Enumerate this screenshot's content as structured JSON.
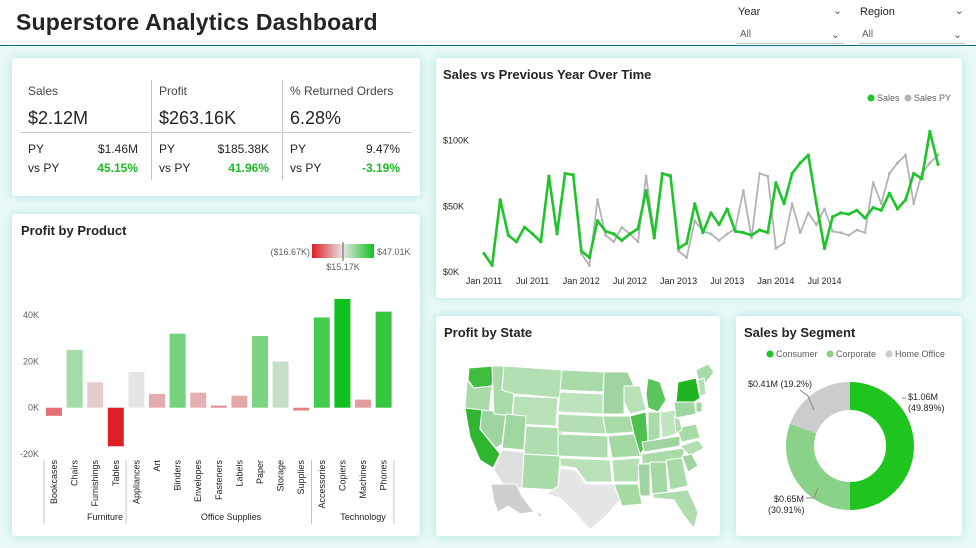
{
  "header": {
    "title": "Superstore Analytics Dashboard",
    "slicers": [
      {
        "label": "Year",
        "value": "All"
      },
      {
        "label": "Region",
        "value": "All"
      }
    ]
  },
  "kpis": [
    {
      "label": "Sales",
      "value": "$2.12M",
      "py_label": "PY",
      "py_value": "$1.46M",
      "vs_label": "vs PY",
      "vs_value": "45.15%"
    },
    {
      "label": "Profit",
      "value": "$263.16K",
      "py_label": "PY",
      "py_value": "$185.38K",
      "vs_label": "vs PY",
      "vs_value": "41.96%"
    },
    {
      "label": "% Returned Orders",
      "value": "6.28%",
      "py_label": "PY",
      "py_value": "9.47%",
      "vs_label": "vs PY",
      "vs_value": "-3.19%"
    }
  ],
  "profit_by_product": {
    "title": "Profit by Product",
    "legend": {
      "min_label": "($16.67K)",
      "mid_label": "$15.17K",
      "max_label": "$47.01K"
    },
    "groups": [
      "Furniture",
      "Office Supplies",
      "Technology"
    ]
  },
  "sales_line": {
    "title": "Sales vs Previous Year Over Time",
    "legend": [
      {
        "name": "Sales",
        "color": "#1fc42a"
      },
      {
        "name": "Sales PY",
        "color": "#b3b3b3"
      }
    ]
  },
  "profit_by_state": {
    "title": "Profit by State"
  },
  "sales_by_segment": {
    "title": "Sales by Segment",
    "legend": [
      {
        "name": "Consumer",
        "color": "#1fc41f"
      },
      {
        "name": "Corporate",
        "color": "#8ad28a"
      },
      {
        "name": "Home Office",
        "color": "#cccccc"
      }
    ],
    "labels": {
      "consumer_value": "$1.06M",
      "consumer_pct": "(49.89%)",
      "corporate_value": "$0.65M",
      "corporate_pct": "(30.91%)",
      "home_label": "$0.41M (19.2%)"
    }
  },
  "chart_data": [
    {
      "type": "bar",
      "title": "Profit by Product",
      "categories": [
        "Bookcases",
        "Chairs",
        "Furnishings",
        "Tables",
        "Appliances",
        "Art",
        "Binders",
        "Envelopes",
        "Fasteners",
        "Labels",
        "Paper",
        "Storage",
        "Supplies",
        "Accessories",
        "Copiers",
        "Machines",
        "Phones"
      ],
      "groups": [
        {
          "name": "Furniture",
          "categories": [
            "Bookcases",
            "Chairs",
            "Furnishings",
            "Tables"
          ]
        },
        {
          "name": "Office Supplies",
          "categories": [
            "Appliances",
            "Art",
            "Binders",
            "Envelopes",
            "Fasteners",
            "Labels",
            "Paper",
            "Storage",
            "Supplies"
          ]
        },
        {
          "name": "Technology",
          "categories": [
            "Accessories",
            "Copiers",
            "Machines",
            "Phones"
          ]
        }
      ],
      "values": [
        -3500,
        25000,
        11000,
        -16670,
        15500,
        6000,
        32000,
        6500,
        900,
        5200,
        31000,
        20000,
        -1200,
        39000,
        47010,
        3500,
        41500
      ],
      "ylim": [
        -20000,
        50000
      ],
      "yticks": [
        "-20K",
        "0K",
        "20K",
        "40K"
      ],
      "color_scale": {
        "min": -16670,
        "mid": 15170,
        "max": 47010,
        "min_color": "#dd1f26",
        "mid_color": "#e6e6e6",
        "max_color": "#11c11f"
      }
    },
    {
      "type": "line",
      "title": "Sales vs Previous Year Over Time",
      "start_month": "2011-01",
      "x_ticks": [
        "Jan 2011",
        "Jul 2011",
        "Jan 2012",
        "Jul 2012",
        "Jan 2013",
        "Jul 2013",
        "Jan 2014",
        "Jul 2014"
      ],
      "y_ticks": [
        "$0K",
        "$50K",
        "$100K"
      ],
      "ylim": [
        0,
        120000
      ],
      "series": [
        {
          "name": "Sales",
          "color": "#1fc42a",
          "values": [
            14000,
            5000,
            55000,
            28000,
            23000,
            34000,
            29000,
            23000,
            73000,
            29000,
            75000,
            74000,
            16000,
            11000,
            39000,
            31000,
            29000,
            24000,
            29000,
            33000,
            62000,
            26000,
            75000,
            73000,
            18000,
            22000,
            52000,
            30000,
            45000,
            36000,
            48000,
            31000,
            30000,
            28000,
            32000,
            30000,
            68000,
            52000,
            75000,
            83000,
            89000,
            52000,
            18000,
            42000,
            45000,
            44000,
            47000,
            41000,
            49000,
            47000,
            60000,
            48000,
            55000,
            75000,
            71000,
            107000,
            82000
          ]
        },
        {
          "name": "Sales PY",
          "color": "#b3b3b3",
          "values": [
            null,
            null,
            null,
            null,
            null,
            null,
            null,
            null,
            null,
            null,
            null,
            null,
            14000,
            5000,
            55000,
            28000,
            23000,
            34000,
            29000,
            23000,
            73000,
            29000,
            75000,
            74000,
            16000,
            11000,
            39000,
            31000,
            29000,
            24000,
            29000,
            33000,
            62000,
            26000,
            75000,
            73000,
            18000,
            22000,
            52000,
            30000,
            45000,
            36000,
            48000,
            31000,
            30000,
            28000,
            32000,
            30000,
            68000,
            52000,
            75000,
            83000,
            89000,
            52000,
            75000,
            83000,
            89000
          ]
        }
      ]
    },
    {
      "type": "pie",
      "title": "Sales by Segment",
      "categories": [
        "Consumer",
        "Corporate",
        "Home Office"
      ],
      "values": [
        1.06,
        0.65,
        0.41
      ],
      "percents": [
        49.89,
        30.91,
        19.2
      ],
      "unit": "$M"
    }
  ]
}
